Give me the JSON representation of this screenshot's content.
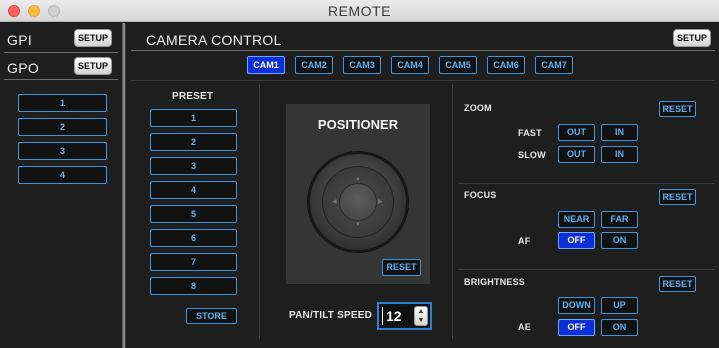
{
  "window": {
    "title": "REMOTE"
  },
  "gpi": {
    "label": "GPI",
    "setup_label": "SETUP"
  },
  "gpo": {
    "label": "GPO",
    "setup_label": "SETUP",
    "buttons": [
      "1",
      "2",
      "3",
      "4"
    ]
  },
  "camera_control": {
    "title": "CAMERA CONTROL",
    "setup_label": "SETUP",
    "cameras": [
      "CAM1",
      "CAM2",
      "CAM3",
      "CAM4",
      "CAM5",
      "CAM6",
      "CAM7"
    ],
    "active_camera": "CAM1"
  },
  "preset": {
    "title": "PRESET",
    "buttons": [
      "1",
      "2",
      "3",
      "4",
      "5",
      "6",
      "7",
      "8"
    ],
    "store_label": "STORE"
  },
  "positioner": {
    "title": "POSITIONER",
    "reset_label": "RESET",
    "speed_label": "PAN/TILT SPEED",
    "speed_value": "12"
  },
  "zoom": {
    "title": "ZOOM",
    "reset_label": "RESET",
    "fast_label": "FAST",
    "slow_label": "SLOW",
    "out_label": "OUT",
    "in_label": "IN"
  },
  "focus": {
    "title": "FOCUS",
    "reset_label": "RESET",
    "near_label": "NEAR",
    "far_label": "FAR",
    "af_label": "AF",
    "off_label": "OFF",
    "on_label": "ON",
    "af_state": "OFF"
  },
  "brightness": {
    "title": "BRIGHTNESS",
    "reset_label": "RESET",
    "down_label": "DOWN",
    "up_label": "UP",
    "ae_label": "AE",
    "off_label": "OFF",
    "on_label": "ON",
    "ae_state": "OFF"
  },
  "colors": {
    "accent_blue": "#3f93d6",
    "active_fill": "#0d2fd8",
    "background": "#1e1e1e"
  }
}
